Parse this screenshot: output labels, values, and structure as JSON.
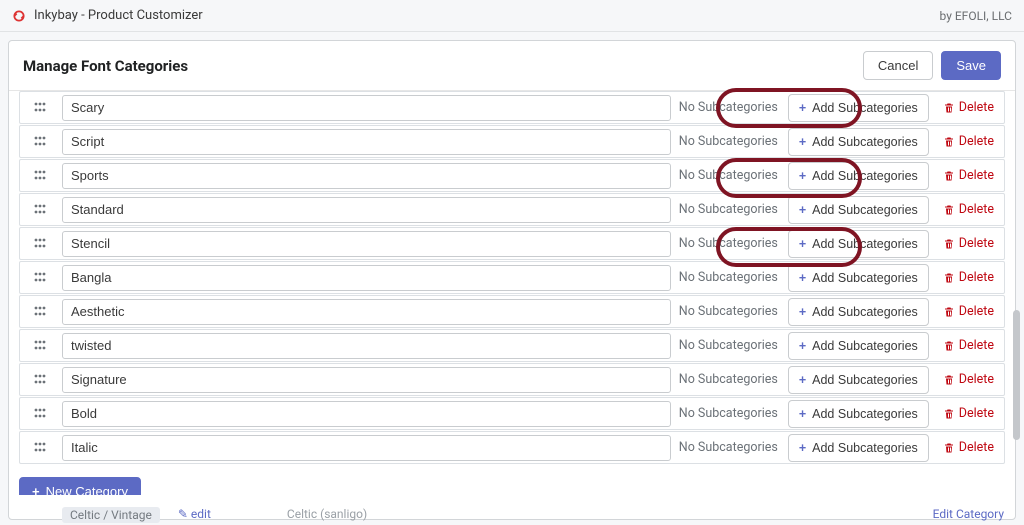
{
  "app": {
    "title": "Inkybay - Product Customizer",
    "by": "by EFOLI, LLC"
  },
  "header": {
    "title": "Manage Font Categories",
    "cancel": "Cancel",
    "save": "Save"
  },
  "row_meta": {
    "no_sub": "No Subcategories",
    "add_sub": "Add Subcategories",
    "delete": "Delete"
  },
  "footer": {
    "new_category": "New Category"
  },
  "ghost": {
    "a": "Celtic / Vintage",
    "edit": "✎ edit",
    "b": "Celtic (sanligo)",
    "editcat": "Edit Category"
  },
  "rows": [
    {
      "name": "Scary",
      "highlight": true
    },
    {
      "name": "Script",
      "highlight": false
    },
    {
      "name": "Sports",
      "highlight": true
    },
    {
      "name": "Standard",
      "highlight": false
    },
    {
      "name": "Stencil",
      "highlight": true
    },
    {
      "name": "Bangla",
      "highlight": false
    },
    {
      "name": "Aesthetic",
      "highlight": false
    },
    {
      "name": "twisted",
      "highlight": false
    },
    {
      "name": "Signature",
      "highlight": false
    },
    {
      "name": "Bold",
      "highlight": false
    },
    {
      "name": "Italic",
      "highlight": false
    }
  ]
}
